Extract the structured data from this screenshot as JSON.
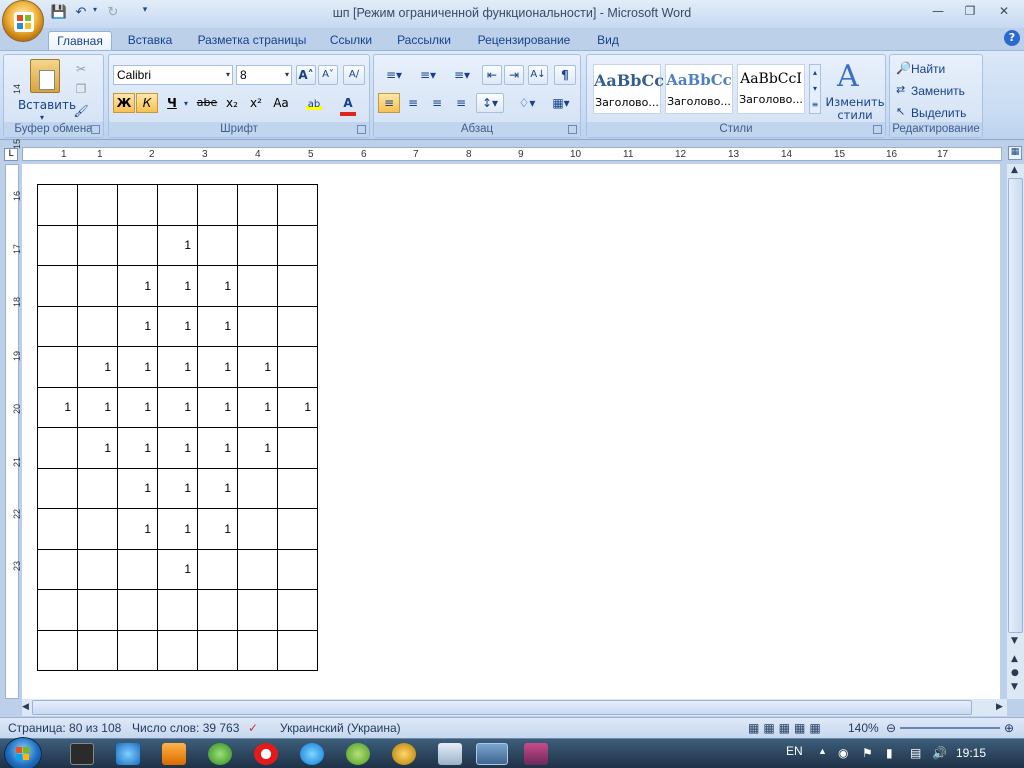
{
  "title_bar": {
    "title": "шп [Режим ограниченной функциональности] - Microsoft Word",
    "qat": [
      "save-icon",
      "undo-icon",
      "redo-icon",
      "customize-icon"
    ]
  },
  "tabs": [
    "Главная",
    "Вставка",
    "Разметка страницы",
    "Ссылки",
    "Рассылки",
    "Рецензирование",
    "Вид"
  ],
  "active_tab": "Главная",
  "ribbon": {
    "clipboard": {
      "label": "Буфер обмена",
      "paste": "Вставить"
    },
    "font": {
      "label": "Шрифт",
      "font_name": "Calibri",
      "font_size": "8",
      "bold": "Ж",
      "italic": "К",
      "underline": "Ч",
      "strike": "abe",
      "subscript": "x₂",
      "superscript": "x²",
      "case": "Aa"
    },
    "paragraph": {
      "label": "Абзац"
    },
    "styles": {
      "label": "Стили",
      "items": [
        {
          "sample": "AaBbCc",
          "name": "Заголово..."
        },
        {
          "sample": "AaBbCc",
          "name": "Заголово..."
        },
        {
          "sample": "AaBbCcI",
          "name": "Заголово..."
        }
      ],
      "change": "Изменить стили"
    },
    "editing": {
      "label": "Редактирование",
      "find": "Найти",
      "replace": "Заменить",
      "select": "Выделить"
    }
  },
  "ruler": {
    "h_numbers": [
      "1",
      "1",
      "2",
      "3",
      "4",
      "5",
      "6",
      "7",
      "8",
      "9",
      "10",
      "11",
      "12",
      "13",
      "14",
      "15",
      "16",
      "17"
    ],
    "v_numbers": [
      "14",
      "15",
      "16",
      "17",
      "18",
      "19",
      "20",
      "21",
      "22",
      "23"
    ]
  },
  "table": {
    "rows": [
      [
        "",
        "",
        "",
        "",
        "",
        "",
        ""
      ],
      [
        "",
        "",
        "",
        "1",
        "",
        "",
        ""
      ],
      [
        "",
        "",
        "1",
        "1",
        "1",
        "",
        ""
      ],
      [
        "",
        "",
        "1",
        "1",
        "1",
        "",
        ""
      ],
      [
        "",
        "1",
        "1",
        "1",
        "1",
        "1",
        ""
      ],
      [
        "1",
        "1",
        "1",
        "1",
        "1",
        "1",
        "1"
      ],
      [
        "",
        "1",
        "1",
        "1",
        "1",
        "1",
        ""
      ],
      [
        "",
        "",
        "1",
        "1",
        "1",
        "",
        ""
      ],
      [
        "",
        "",
        "1",
        "1",
        "1",
        "",
        ""
      ],
      [
        "",
        "",
        "",
        "1",
        "",
        "",
        ""
      ],
      [
        "",
        "",
        "",
        "",
        "",
        "",
        ""
      ],
      [
        "",
        "",
        "",
        "",
        "",
        "",
        ""
      ]
    ]
  },
  "status": {
    "page": "Страница: 80 из 108",
    "words": "Число слов: 39 763",
    "language": "Украинский (Украина)",
    "zoom": "140%"
  },
  "taskbar": {
    "lang": "EN",
    "time": "19:15"
  }
}
